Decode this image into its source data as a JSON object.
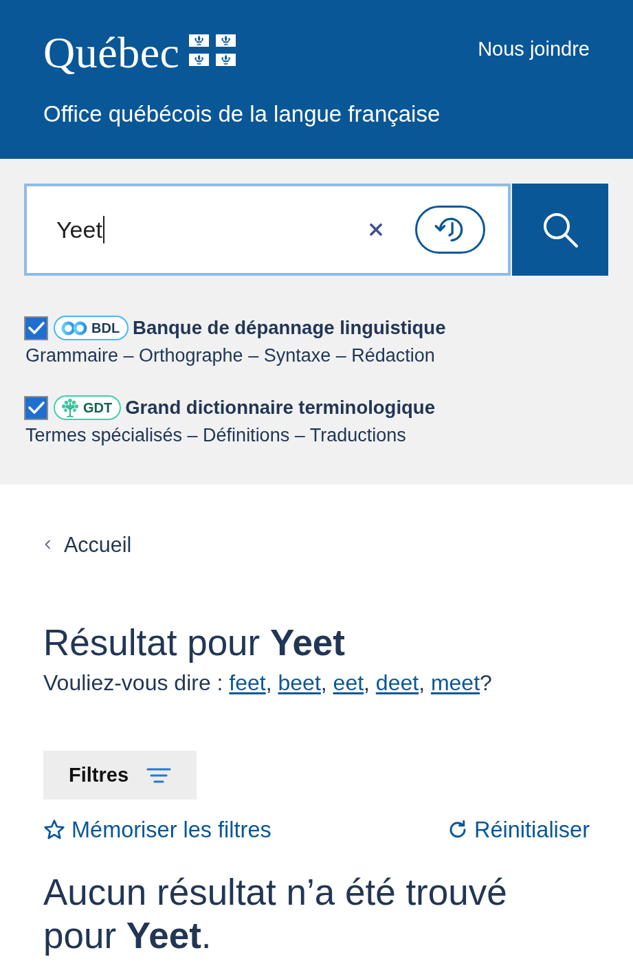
{
  "header": {
    "logo": "Québec",
    "contact_link": "Nous joindre",
    "subtitle": "Office québécois de la langue française"
  },
  "search": {
    "value": "Yeet",
    "focused": true,
    "sources": [
      {
        "kind": "bdl",
        "badge": "BDL",
        "color": "#45b8f5",
        "checked": true,
        "title": "Banque de dépannage linguistique",
        "description": "Grammaire – Orthographe – Syntaxe – Rédaction"
      },
      {
        "kind": "gdt",
        "badge": "GDT",
        "color": "#3fd0ad",
        "checked": true,
        "title": "Grand dictionnaire terminologique",
        "description": "Termes spécialisés – Définitions – Traductions"
      }
    ]
  },
  "breadcrumb": {
    "label": "Accueil"
  },
  "results": {
    "heading": "Résultat pour **Yeet**",
    "did_you_mean": {
      "prefix": "Vouliez-vous dire :",
      "words": [
        "feet",
        "beet",
        "eet",
        "deet",
        "meet"
      ],
      "separator": ",",
      "ending": "?"
    },
    "filters_button": "Filtres",
    "save_filters": "Mémoriser les filtres",
    "reset": "Réinitialiser",
    "no_results": "Aucun résultat n’a été trouvé pour **Yeet**."
  }
}
